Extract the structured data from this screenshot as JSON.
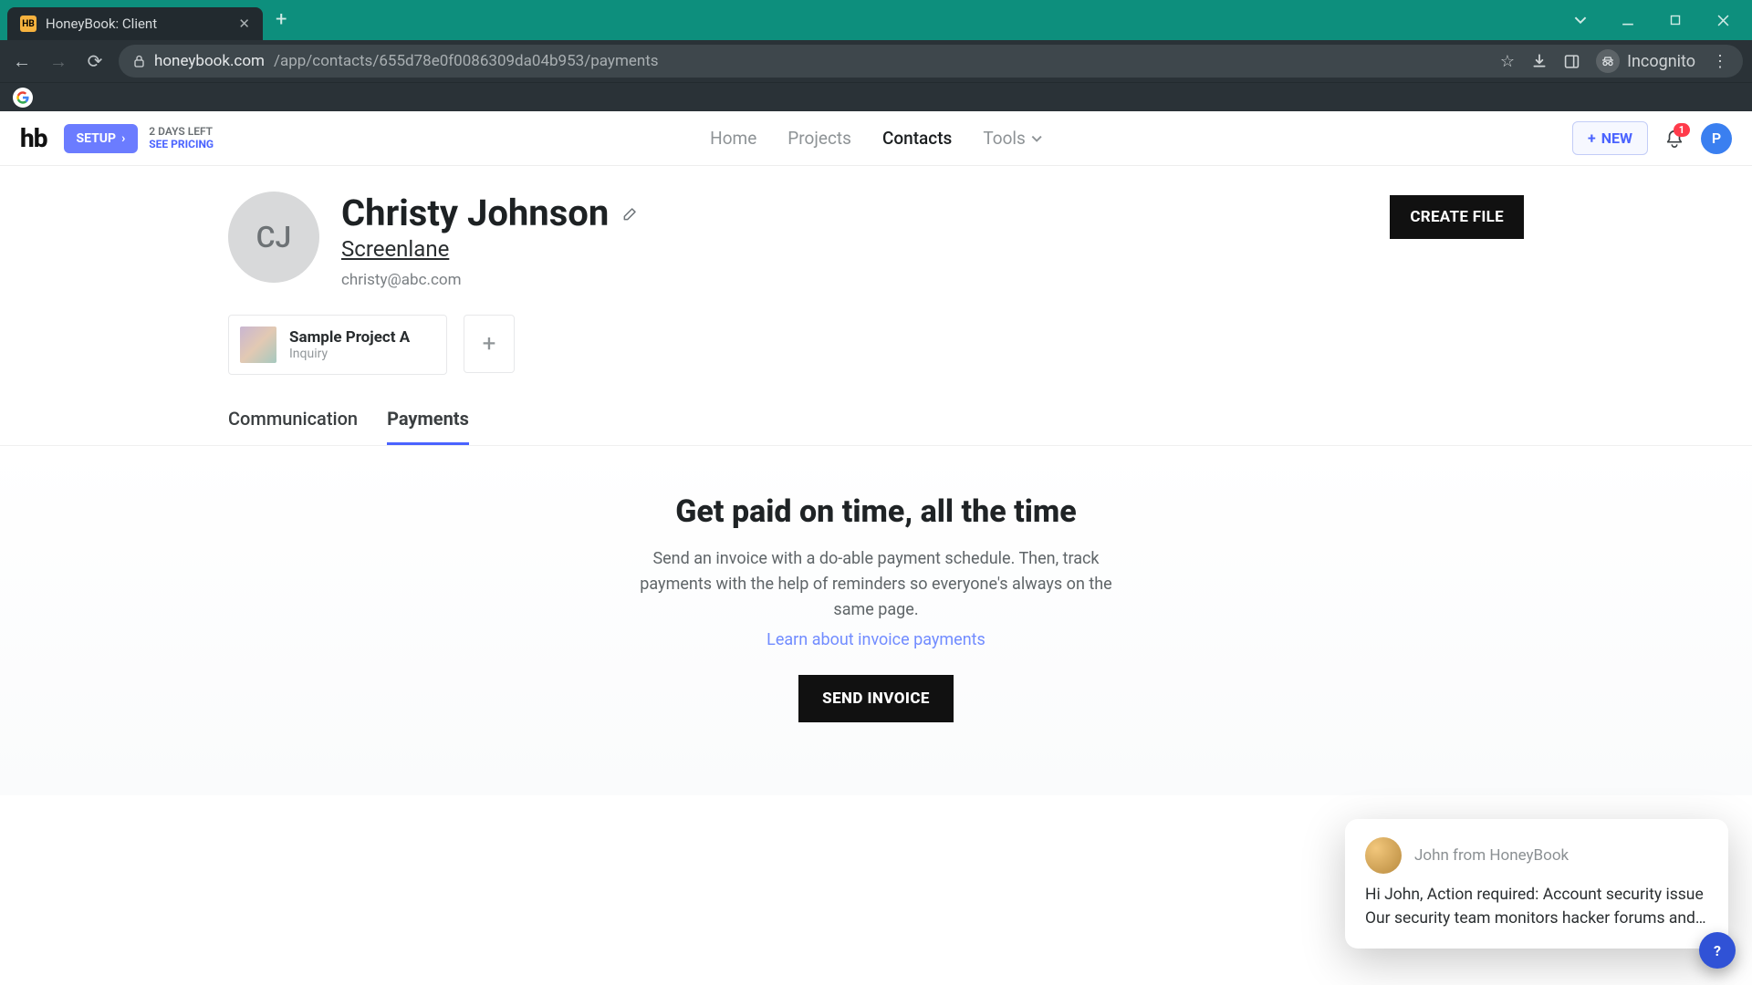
{
  "browser": {
    "tab_title": "HoneyBook: Client",
    "url_host": "honeybook.com",
    "url_path": "/app/contacts/655d78e0f0086309da04b953/payments",
    "incognito_label": "Incognito"
  },
  "topnav": {
    "setup_label": "SETUP",
    "trial_line1": "2 DAYS LEFT",
    "trial_line2": "SEE PRICING",
    "links": {
      "home": "Home",
      "projects": "Projects",
      "contacts": "Contacts",
      "tools": "Tools"
    },
    "new_button": "NEW",
    "notif_count": "1",
    "avatar_letter": "P"
  },
  "contact": {
    "initials": "CJ",
    "name": "Christy Johnson",
    "company": "Screenlane",
    "email": "christy@abc.com",
    "create_file": "CREATE FILE"
  },
  "projects": [
    {
      "title": "Sample Project A",
      "status": "Inquiry"
    }
  ],
  "tabs": {
    "communication": "Communication",
    "payments": "Payments"
  },
  "empty": {
    "heading": "Get paid on time, all the time",
    "body": "Send an invoice with a do-able payment schedule. Then, track payments with the help of reminders so everyone's always on the same page.",
    "learn": "Learn about invoice payments",
    "cta": "SEND INVOICE"
  },
  "chat": {
    "from": "John from HoneyBook",
    "line1": "Hi John, Action required: Account security issue",
    "line2": "Our security team monitors hacker forums and…"
  }
}
